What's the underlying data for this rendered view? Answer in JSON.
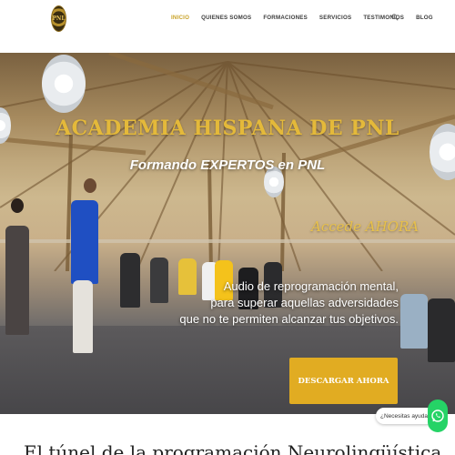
{
  "header": {
    "logo_text": "PNL",
    "nav": [
      {
        "label": "INICIO"
      },
      {
        "label": "QUIENES SOMOS"
      },
      {
        "label": "FORMACIONES"
      },
      {
        "label": "SERVICIOS"
      },
      {
        "label": "TESTIMONIOS"
      },
      {
        "label": "BLOG"
      }
    ],
    "search_icon": "search-icon"
  },
  "colors": {
    "accent": "#c9a227",
    "button": "#e1ac22",
    "whatsapp": "#25d366"
  },
  "hero": {
    "title": "ACADEMIA HISPANA DE PNL",
    "subtitle": "Formando EXPERTOS en PNL",
    "accede": "Accede AHORA",
    "description_lines": [
      "Audio de reprogramación mental,",
      "para superar aquellas adversidades",
      "que no te permiten alcanzar tus objetivos."
    ],
    "button_label": "DESCARGAR AHORA"
  },
  "chat": {
    "help_text": "¿Necesitas ayuda?",
    "icon": "whatsapp-icon"
  },
  "section": {
    "heading": "El túnel de la programación Neurolingüística"
  }
}
